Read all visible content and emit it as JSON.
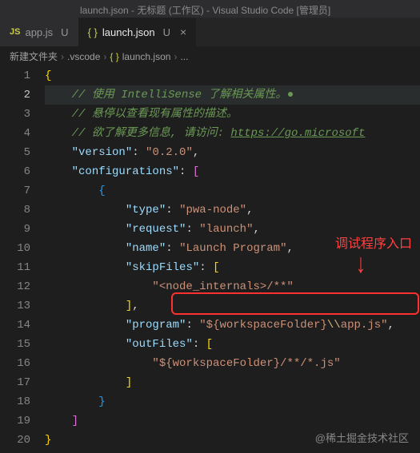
{
  "titlebar": "launch.json - 无标题 (工作区) - Visual Studio Code [管理员]",
  "tabs": {
    "t1": {
      "icon": "JS",
      "label": "app.js",
      "mod": "U"
    },
    "t2": {
      "icon": "{ }",
      "label": "launch.json",
      "mod": "U",
      "close": "×"
    }
  },
  "breadcrumb": {
    "b1": "新建文件夹",
    "b2": ".vscode",
    "b3icon": "{ }",
    "b3": "launch.json",
    "b4": "...",
    "sep": "›"
  },
  "lines": {
    "l1": "1",
    "l2": "2",
    "l3": "3",
    "l4": "4",
    "l5": "5",
    "l6": "6",
    "l7": "7",
    "l8": "8",
    "l9": "9",
    "l10": "10",
    "l11": "11",
    "l12": "12",
    "l13": "13",
    "l14": "14",
    "l15": "15",
    "l16": "16",
    "l17": "17",
    "l18": "18",
    "l19": "19",
    "l20": "20"
  },
  "code": {
    "c1a": "// 使用 IntelliSense 了解相关属性。",
    "c2": "// 悬停以查看现有属性的描述。",
    "c3a": "// 欲了解更多信息, 请访问: ",
    "c3b": "https://go.microsoft",
    "version_k": "\"version\"",
    "version_v": "\"0.2.0\"",
    "configs_k": "\"configurations\"",
    "type_k": "\"type\"",
    "type_v": "\"pwa-node\"",
    "request_k": "\"request\"",
    "request_v": "\"launch\"",
    "name_k": "\"name\"",
    "name_v": "\"Launch Program\"",
    "skip_k": "\"skipFiles\"",
    "skip_v": "\"<node_internals>/**\"",
    "program_k": "\"program\"",
    "program_v1": "\"${workspaceFolder}",
    "program_esc": "\\\\",
    "program_v2": "app.js\"",
    "out_k": "\"outFiles\"",
    "out_v": "\"${workspaceFolder}/**/*.js\""
  },
  "annotation": {
    "text": "调试程序入口",
    "arrow": "↓"
  },
  "watermark": "@稀土掘金技术社区"
}
